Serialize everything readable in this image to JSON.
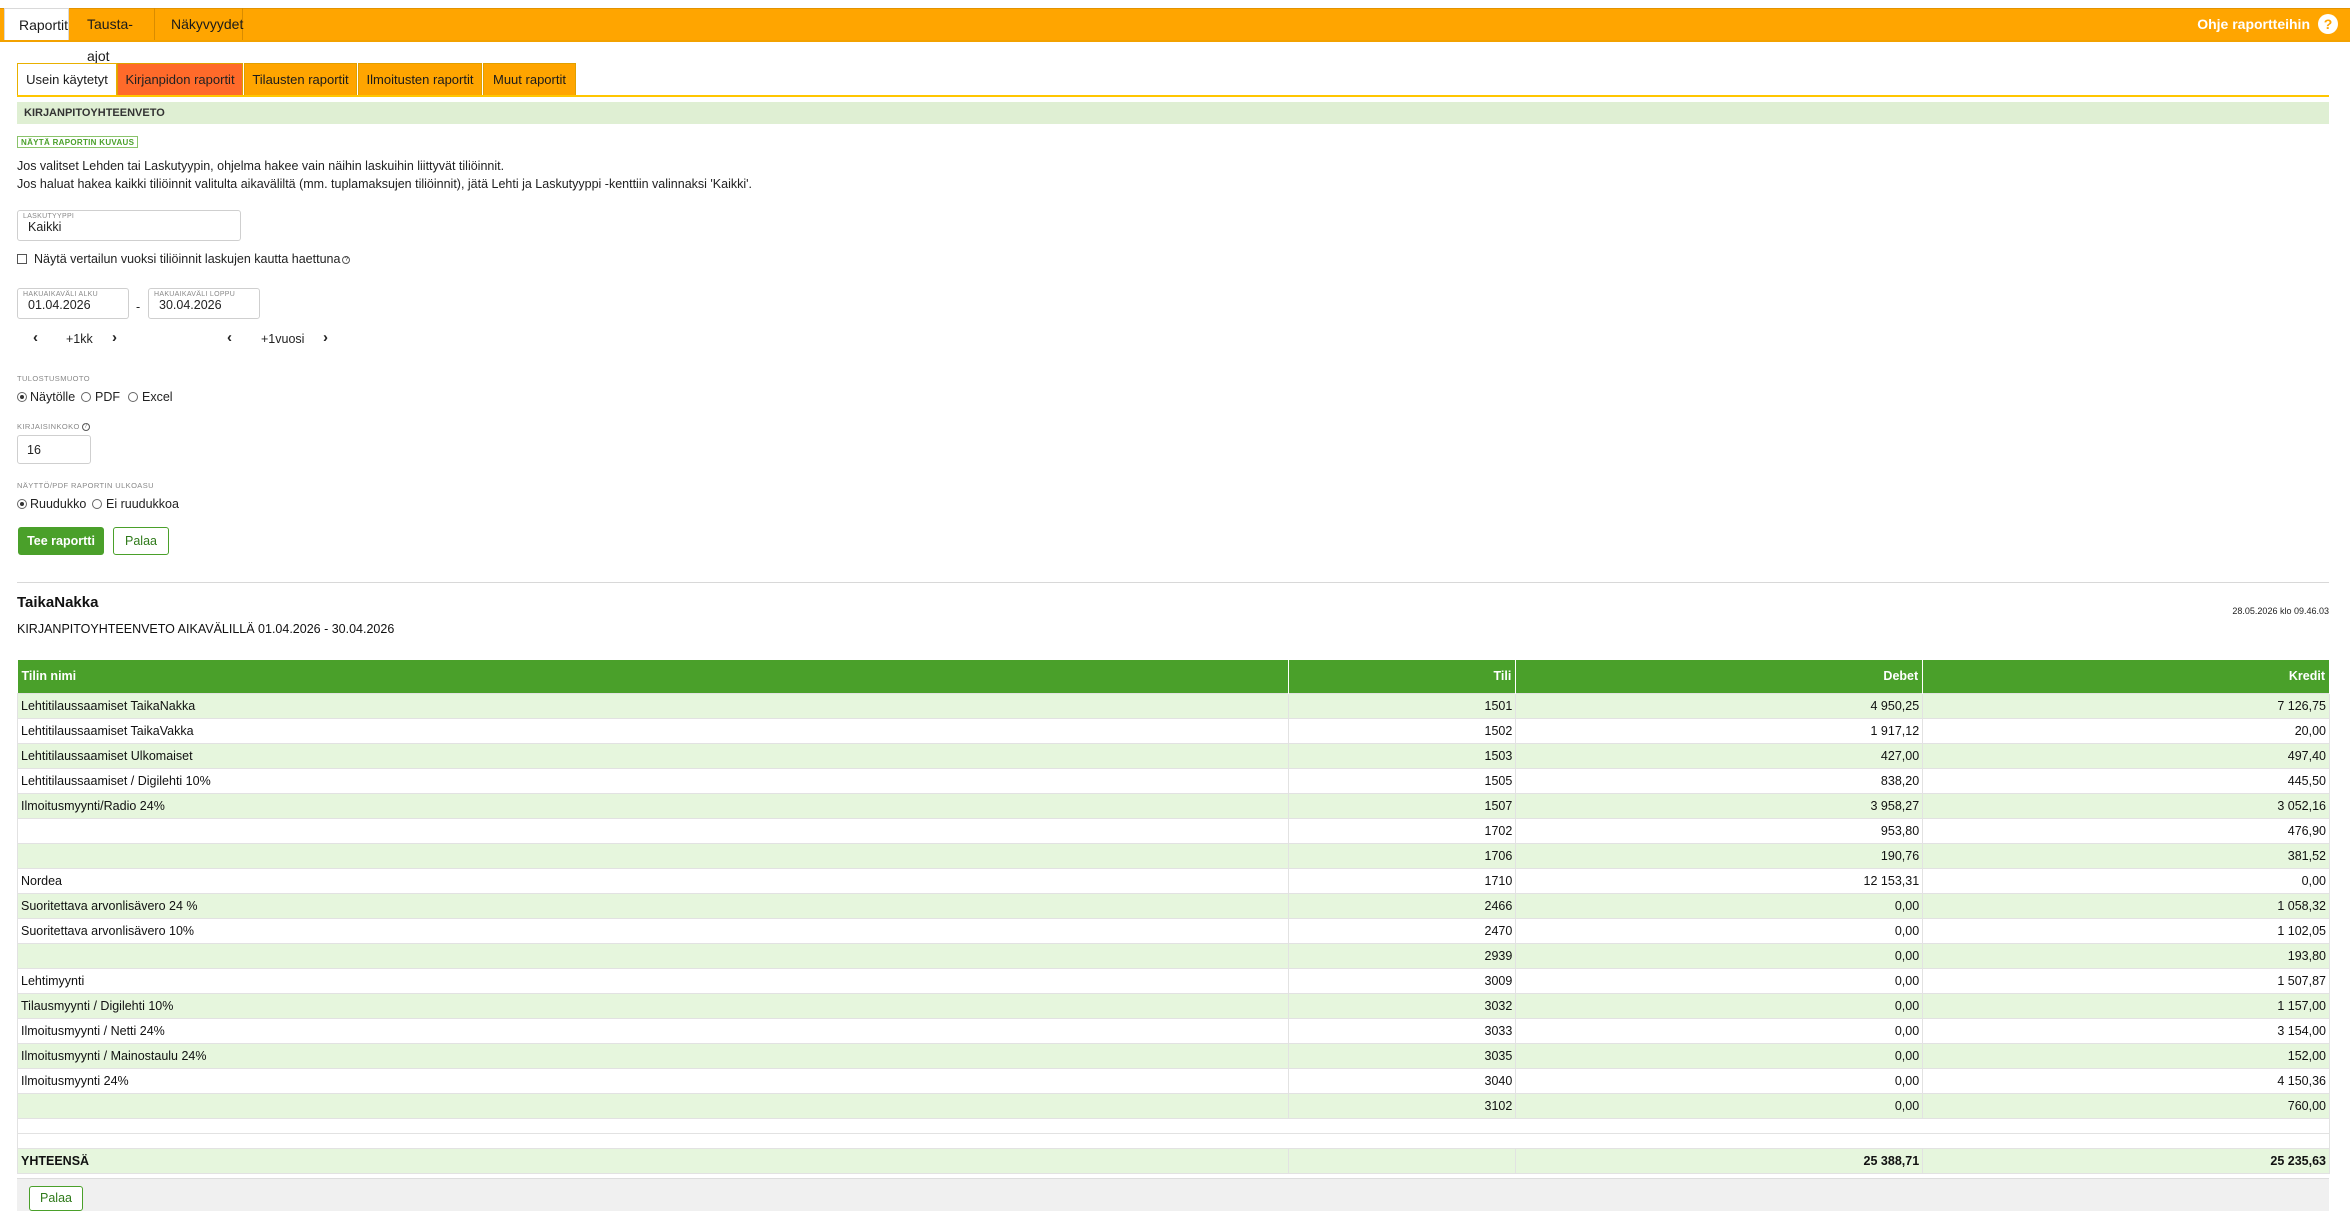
{
  "top_tabs": [
    {
      "label": "Raportit",
      "active": true
    },
    {
      "label": "Tausta-ajot",
      "active": false
    },
    {
      "label": "Näkyvyydet",
      "active": false
    }
  ],
  "help": {
    "label": "Ohje raportteihin",
    "icon": "help-icon"
  },
  "sub_tabs": [
    {
      "label": "Usein käytetyt",
      "active": true
    },
    {
      "label": "Kirjanpidon raportit",
      "highlight": true
    },
    {
      "label": "Tilausten raportit"
    },
    {
      "label": "Ilmoitusten raportit"
    },
    {
      "label": "Muut raportit"
    }
  ],
  "section_title": "KIRJANPITOYHTEENVETO",
  "description_toggle": "NÄYTÄ RAPORTIN KUVAUS",
  "info_lines": [
    "Jos valitset Lehden tai Laskutyypin, ohjelma hakee vain näihin laskuihin liittyvät tiliöinnit.",
    "Jos haluat hakea kaikki tiliöinnit valitulta aikaväliltä (mm. tuplamaksujen tiliöinnit), jätä Lehti ja Laskutyyppi -kenttiin valinnaksi 'Kaikki'."
  ],
  "billing_type": {
    "label": "LASKUTYYPPI",
    "value": "Kaikki"
  },
  "compare_checkbox": {
    "label": "Näytä vertailun vuoksi tiliöinnit laskujen kautta haettuna",
    "checked": false
  },
  "date_range": {
    "start": {
      "label": "HAKUAIKAVÄLI ALKU",
      "value": "01.04.2026"
    },
    "separator": "-",
    "end": {
      "label": "HAKUAIKAVÄLI LOPPU",
      "value": "30.04.2026"
    },
    "step_month": "+1kk",
    "step_year": "+1vuosi"
  },
  "output_format": {
    "label": "TULOSTUSMUOTO",
    "options": [
      "Näytölle",
      "PDF",
      "Excel"
    ],
    "selected": "Näytölle"
  },
  "font_size": {
    "label": "KIRJAISINKOKO",
    "value": "16"
  },
  "layout": {
    "label": "NÄYTTÖ/PDF RAPORTIN ULKOASU",
    "options": [
      "Ruudukko",
      "Ei ruudukkoa"
    ],
    "selected": "Ruudukko"
  },
  "buttons": {
    "run": "Tee raportti",
    "back": "Palaa"
  },
  "report": {
    "company": "TaikaNakka",
    "title": "KIRJANPITOYHTEENVETO AIKAVÄLILLÄ 01.04.2026 - 30.04.2026",
    "timestamp": "28.05.2026 klo 09.46.03",
    "columns": [
      "Tilin nimi",
      "Tili",
      "Debet",
      "Kredit"
    ],
    "rows": [
      [
        "Lehtitilaussaamiset TaikaNakka",
        "1501",
        "4 950,25",
        "7 126,75"
      ],
      [
        "Lehtitilaussaamiset TaikaVakka",
        "1502",
        "1 917,12",
        "20,00"
      ],
      [
        "Lehtitilaussaamiset Ulkomaiset",
        "1503",
        "427,00",
        "497,40"
      ],
      [
        "Lehtitilaussaamiset / Digilehti 10%",
        "1505",
        "838,20",
        "445,50"
      ],
      [
        "Ilmoitusmyynti/Radio 24%",
        "1507",
        "3 958,27",
        "3 052,16"
      ],
      [
        "",
        "1702",
        "953,80",
        "476,90"
      ],
      [
        "",
        "1706",
        "190,76",
        "381,52"
      ],
      [
        "Nordea",
        "1710",
        "12 153,31",
        "0,00"
      ],
      [
        "Suoritettava arvonlisävero 24 %",
        "2466",
        "0,00",
        "1 058,32"
      ],
      [
        "Suoritettava arvonlisävero 10%",
        "2470",
        "0,00",
        "1 102,05"
      ],
      [
        "",
        "2939",
        "0,00",
        "193,80"
      ],
      [
        "Lehtimyynti",
        "3009",
        "0,00",
        "1 507,87"
      ],
      [
        "Tilausmyynti / Digilehti 10%",
        "3032",
        "0,00",
        "1 157,00"
      ],
      [
        "Ilmoitusmyynti / Netti 24%",
        "3033",
        "0,00",
        "3 154,00"
      ],
      [
        "Ilmoitusmyynti / Mainostaulu 24%",
        "3035",
        "0,00",
        "152,00"
      ],
      [
        "Ilmoitusmyynti 24%",
        "3040",
        "0,00",
        "4 150,36"
      ],
      [
        "",
        "3102",
        "0,00",
        "760,00"
      ]
    ],
    "total": {
      "label": "YHTEENSÄ",
      "debet": "25 388,71",
      "kredit": "25 235,63"
    }
  },
  "colors": {
    "orange": "#ffa500",
    "green": "#4aa02a",
    "light_green": "#e6f6dd",
    "red_tab": "#ff6a2a"
  }
}
